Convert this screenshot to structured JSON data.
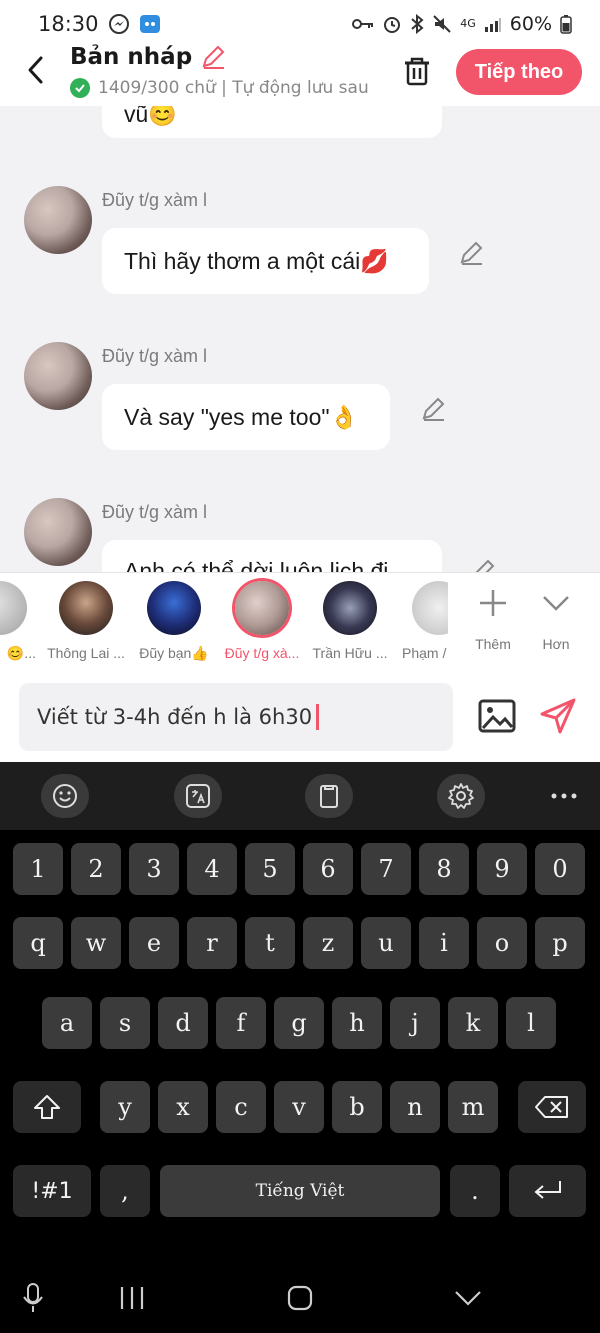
{
  "status_bar": {
    "time": "18:30",
    "battery": "60%",
    "network": "4G"
  },
  "header": {
    "title": "Bản nháp",
    "subtitle": "1409/300 chữ | Tự động lưu sau",
    "next_label": "Tiếp theo"
  },
  "chat": {
    "partial_top_text": "vũ😊",
    "messages": [
      {
        "sender": "Đũy t/g xàm l",
        "text": "Thì hãy thơm a một cái💋"
      },
      {
        "sender": "Đũy t/g xàm l",
        "text": "Và say \"yes me too\"👌"
      },
      {
        "sender": "Đũy t/g xàm l",
        "text": "Anh có thể dời luôn lịch đi"
      }
    ]
  },
  "characters": {
    "items": [
      {
        "name": "😊..."
      },
      {
        "name": "Thông Lai ..."
      },
      {
        "name": "Đũy bạn👍"
      },
      {
        "name": "Đũy t/g xà..."
      },
      {
        "name": "Trần Hữu ..."
      },
      {
        "name": "Phạm /"
      }
    ],
    "more_label": "Thêm",
    "less_label": "Hơn"
  },
  "composer": {
    "value": "Viết từ 3-4h đến h là 6h30"
  },
  "keyboard": {
    "row_numbers": [
      "1",
      "2",
      "3",
      "4",
      "5",
      "6",
      "7",
      "8",
      "9",
      "0"
    ],
    "row_1": [
      "q",
      "w",
      "e",
      "r",
      "t",
      "z",
      "u",
      "i",
      "o",
      "p"
    ],
    "row_2": [
      "a",
      "s",
      "d",
      "f",
      "g",
      "h",
      "j",
      "k",
      "l"
    ],
    "row_3": [
      "y",
      "x",
      "c",
      "v",
      "b",
      "n",
      "m"
    ],
    "symbols_label": "!#1",
    "comma": ",",
    "space_label": "Tiếng Việt",
    "period": "."
  },
  "colors": {
    "accent": "#f2546a",
    "check": "#31b057"
  }
}
